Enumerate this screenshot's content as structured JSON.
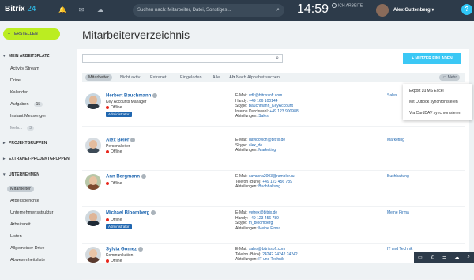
{
  "topbar": {
    "logo_text": "Bitrix",
    "logo_num": "24",
    "search_placeholder": "Suchen nach: Mitarbeiter, Datei, Sonstiges...",
    "clock": "14:59",
    "status_line1": "",
    "status_line2": "ICH ARBEITE",
    "user_name": "Alex Guttenberg",
    "help": "?"
  },
  "sidebar": {
    "create_label": "ERSTELLEN",
    "section_main": "MEIN ARBEITSPLATZ",
    "items": [
      {
        "label": "Activity Stream"
      },
      {
        "label": "Drive"
      },
      {
        "label": "Kalender"
      },
      {
        "label": "Aufgaben",
        "badge": "15"
      },
      {
        "label": "Instant Messenger"
      },
      {
        "label": "Mehr...",
        "badge": "3"
      }
    ],
    "section_groups": "PROJEKTGRUPPEN",
    "section_extranet": "EXTRANET-PROJEKTGRUPPEN",
    "section_company": "UNTERNEHMEN",
    "company_items": [
      {
        "label": "Mitarbeiter"
      },
      {
        "label": "Arbeitsberichte"
      },
      {
        "label": "Unternehmensstruktur"
      },
      {
        "label": "Arbeitszeit"
      },
      {
        "label": "Listen"
      },
      {
        "label": "Allgemeiner Drive"
      },
      {
        "label": "Abwesenheitsliste"
      }
    ]
  },
  "main": {
    "title": "Mitarbeiterverzeichnis",
    "invite_label": "+ NUTZER EINLADEN",
    "filters": [
      "Mitarbeiter",
      "Nicht aktiv",
      "Extranet",
      "Eingeladen",
      "Alle"
    ],
    "alpha_label": "Nach Alphabet suchen",
    "more_label": "Mehr"
  },
  "dropdown": [
    "Export zu MS Excel",
    "Mit Outlook synchronisieren",
    "Via CardDAV synchronisieren"
  ],
  "employees": [
    {
      "name": "Herbert Bauchmann",
      "position": "Key Accounts Manager",
      "status": "Offline",
      "admin": "Administrator",
      "lines": [
        {
          "k": "E-Mail:",
          "v": "vdk@bitrixsoft.com"
        },
        {
          "k": "Handy:",
          "v": "+49 166 100144"
        },
        {
          "k": "Skype:",
          "v": "Bauchmann_KeyAccount"
        },
        {
          "k": "Interne Durchwahl:",
          "v": "+49 123 900988"
        },
        {
          "k": "Abteilungen:",
          "v": "Sales"
        }
      ],
      "dept": "Sales"
    },
    {
      "name": "Alex Beier",
      "position": "Personalleiter",
      "status": "Offline",
      "admin": "",
      "lines": [
        {
          "k": "E-Mail:",
          "v": "davidovich@bitrix.de"
        },
        {
          "k": "Skype:",
          "v": "alex_de"
        },
        {
          "k": "Abteilungen:",
          "v": "Marketing"
        }
      ],
      "dept": "Marketing"
    },
    {
      "name": "Ann Bergmann",
      "position": "",
      "status": "Offline",
      "admin": "",
      "lines": [
        {
          "k": "E-Mail:",
          "v": "savanna2003@rambler.ru"
        },
        {
          "k": "Telefon (Büro):",
          "v": "+49 123 456 789"
        },
        {
          "k": "Abteilungen:",
          "v": "Buchhaltung"
        }
      ],
      "dept": "Buchhaltung"
    },
    {
      "name": "Michael Bloomberg",
      "position": "",
      "status": "Offline",
      "admin": "Administrator",
      "lines": [
        {
          "k": "E-Mail:",
          "v": "vetrex@bitrix.de"
        },
        {
          "k": "Handy:",
          "v": "+49 123 456 789"
        },
        {
          "k": "Skype:",
          "v": "m_bloomberg"
        },
        {
          "k": "Abteilungen:",
          "v": "Meine Firma"
        }
      ],
      "dept": "Meine Firma"
    },
    {
      "name": "Sylvia Gomez",
      "position": "Kommunikation",
      "status": "Offline",
      "admin": "",
      "lines": [
        {
          "k": "E-Mail:",
          "v": "sales@bitrixsoft.com"
        },
        {
          "k": "Telefon (Büro):",
          "v": "24242 24242 24242"
        },
        {
          "k": "Abteilungen:",
          "v": "IT und Technik"
        }
      ],
      "dept": "IT und Technik"
    }
  ],
  "colors": {
    "accent": "#2067b0",
    "create": "#bbed21",
    "invite": "#3bc8f5",
    "offline": "#e8271c",
    "topbar": "#2d3b4a"
  }
}
